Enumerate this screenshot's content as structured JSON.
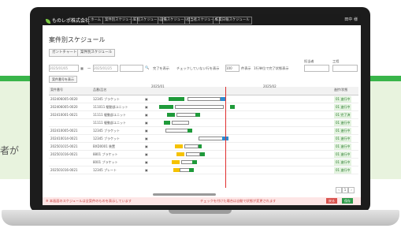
{
  "background": {
    "partial_text": "者が"
  },
  "app": {
    "logo": "ものレポ株式会社",
    "nav_tabs": [
      "ホーム",
      "案件別スケジュール",
      "工程スケジュール",
      "設備スケジュール",
      "担当者スケジュール",
      "作業日報スケジュール"
    ],
    "user": "田中 様"
  },
  "page": {
    "title": "案件別スケジュール"
  },
  "toolbar": {
    "btn_left": "ガントチャート",
    "btn_right": "案件別スケジュール"
  },
  "filters": {
    "start_date": "2025/01/05",
    "to_label": "〜",
    "end_date": "2025/01/25",
    "checkbox1": "完了を表示",
    "checkbox2": "チェックしていない行を表示",
    "select": "100",
    "per_label": "件表示",
    "checkbox3": "1行単位で完了状態表示",
    "col_label1": "担当者",
    "col_label2": "工程"
  },
  "grid": {
    "group_button": "案件番号を表示",
    "col_no": "案件番号",
    "col_name": "品番/品名",
    "months": [
      "2025/01",
      "2025/02"
    ],
    "status_header": "進捗/状態",
    "rows": [
      {
        "no": "202406005-0020",
        "name": "12345 ブラケット",
        "status": "01 進行中"
      },
      {
        "no": "202406005-0020",
        "name": "111011 駆動部ユニット",
        "status": "01 進行中"
      },
      {
        "no": "202410001-0021",
        "name": "11111 駆動部ユニット",
        "status": "01 完了済"
      },
      {
        "no": "",
        "name": "11111 駆動部ユニット",
        "status": "01 進行中"
      },
      {
        "no": "202410005-0021",
        "name": "12345 ブラケット",
        "status": "01 進行中"
      },
      {
        "no": "202410014-0021",
        "name": "12345 ブラケット",
        "status": "01 進行中"
      },
      {
        "no": "202501015-0021",
        "name": "BXD0001 装置",
        "status": "01 進行中"
      },
      {
        "no": "202501016-0021",
        "name": "8801 ブラケット",
        "status": "01 進行中"
      },
      {
        "no": "",
        "name": "8001 ブラケット",
        "status": "01 進行中"
      },
      {
        "no": "202501016-0021",
        "name": "12345 プレート",
        "status": "01 進行中"
      }
    ]
  },
  "footer": {
    "note": "※ 本画面のスケジュールは全案件のものを表示しています",
    "warn": "チェックを付けた場合は自動で状態が変更されます",
    "btn1": "戻る",
    "btn2": "保存"
  },
  "colors": {
    "accent_green": "#39b54a",
    "bar_green": "#1f9a3a",
    "bar_blue": "#2d8bd1",
    "bar_yellow": "#f5c200",
    "today_line": "#e03030"
  }
}
